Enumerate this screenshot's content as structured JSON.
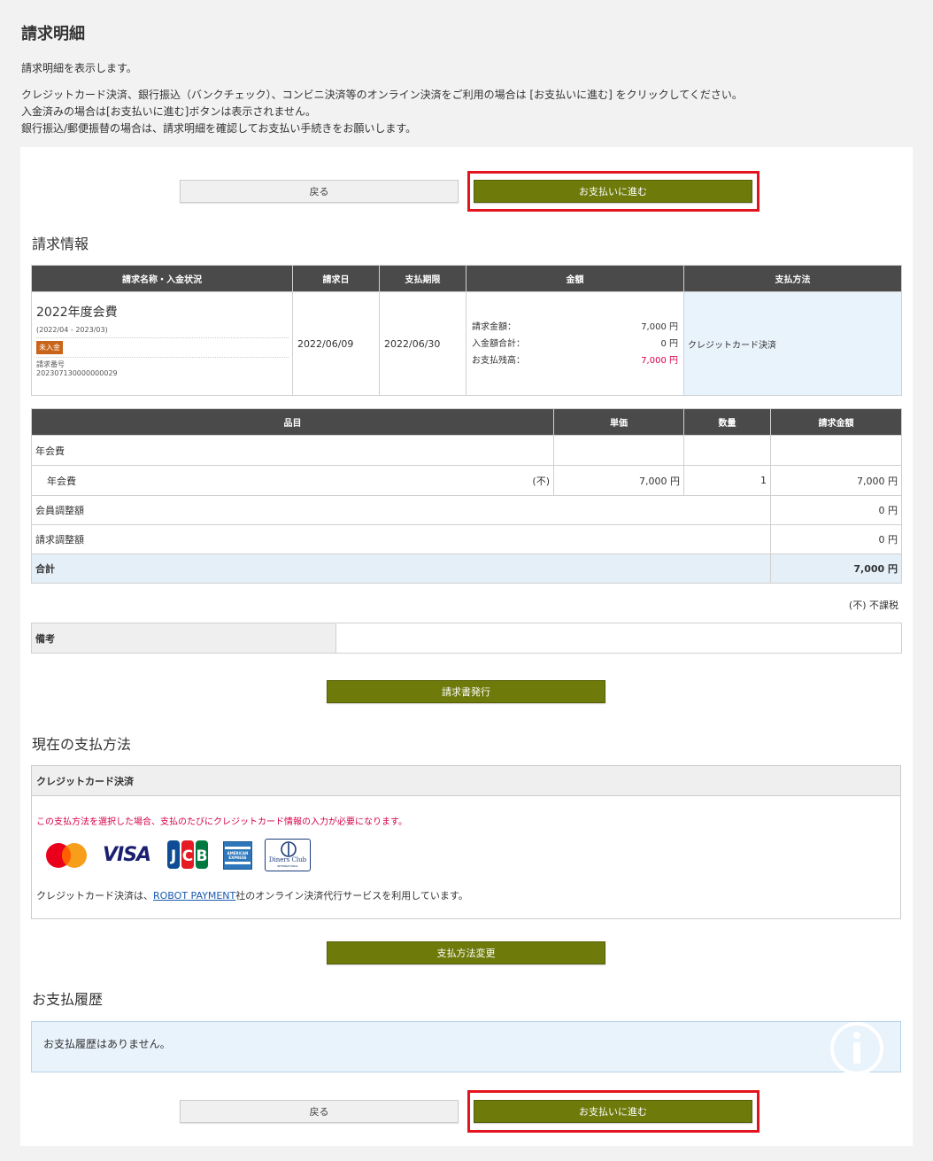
{
  "page": {
    "title": "請求明細",
    "intro": [
      "請求明細を表示します。",
      "クレジットカード決済、銀行振込（バンクチェック）、コンビニ決済等のオンライン決済をご利用の場合は [お支払いに進む] をクリックしてください。",
      "入金済みの場合は[お支払いに進む]ボタンは表示されません。",
      "銀行振込/郵便振替の場合は、請求明細を確認してお支払い手続きをお願いします。"
    ]
  },
  "buttons": {
    "back": "戻る",
    "proceed": "お支払いに進む",
    "issue_invoice": "請求書発行",
    "change_method": "支払方法変更"
  },
  "billing": {
    "heading": "請求情報",
    "columns": [
      "請求名称・入金状況",
      "請求日",
      "支払期限",
      "金額",
      "支払方法"
    ],
    "name": "2022年度会費",
    "period": "(2022/04 - 2023/03)",
    "status": "未入金",
    "number_label": "請求番号",
    "number": "202307130000000029",
    "issue_date": "2022/06/09",
    "due_date": "2022/06/30",
    "amount_label": "請求金額：",
    "amount": "7,000 円",
    "paid_label": "入金額合計：",
    "paid": "0 円",
    "balance_label": "お支払残高：",
    "balance": "7,000 円",
    "method": "クレジットカード決済"
  },
  "items": {
    "columns": [
      "品目",
      "単価",
      "数量",
      "請求金額"
    ],
    "group": "年会費",
    "item_name": "年会費",
    "tax_mark": "(不)",
    "unit_price": "7,000 円",
    "qty": "1",
    "item_amount": "7,000 円",
    "member_adj_label": "会員調整額",
    "member_adj": "0 円",
    "bill_adj_label": "請求調整額",
    "bill_adj": "0 円",
    "total_label": "合計",
    "total": "7,000 円",
    "tax_note": "(不) 不課税",
    "remarks_label": "備考",
    "remarks": ""
  },
  "method": {
    "heading": "現在の支払方法",
    "name": "クレジットカード決済",
    "warning": "この支払方法を選択した場合、支払のたびにクレジットカード情報の入力が必要になります。",
    "note_prefix": "クレジットカード決済は、",
    "link": "ROBOT PAYMENT",
    "note_suffix": "社のオンライン決済代行サービスを利用しています。",
    "cards": [
      "mastercard-logo",
      "visa-logo",
      "jcb-logo",
      "amex-logo",
      "diners-logo"
    ],
    "visa_text": "VISA",
    "amex_text": "AMERICAN EXPRESS",
    "diners_text": "Diners Club",
    "diners_sub": "INTERNATIONAL"
  },
  "history": {
    "heading": "お支払履歴",
    "empty": "お支払履歴はありません。"
  },
  "colors": {
    "olive": "#6e7b0b",
    "highlight": "#e4141e",
    "header": "#4a4a4a",
    "unpaid": "#c8651a",
    "balance": "#d6004a"
  }
}
